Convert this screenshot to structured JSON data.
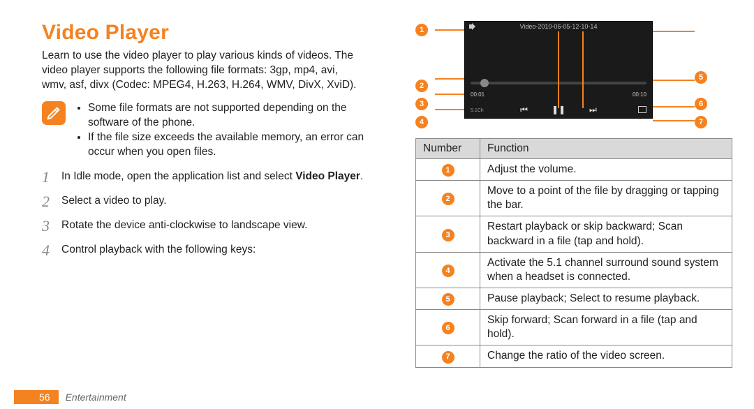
{
  "title": "Video Player",
  "intro": "Learn to use the video player to play various kinds of videos. The video player supports the following file formats: 3gp, mp4, avi, wmv, asf, divx (Codec: MPEG4, H.263, H.264, WMV, DivX, XviD).",
  "notes": [
    "Some file formats are not supported depending on the software of the phone.",
    "If the file size exceeds the available memory, an error can occur when you open files."
  ],
  "steps": [
    {
      "text_pre": "In Idle mode, open the application list and select ",
      "bold": "Video Player",
      "text_post": "."
    },
    {
      "text_pre": "Select a video to play."
    },
    {
      "text_pre": "Rotate the device anti-clockwise to landscape view."
    },
    {
      "text_pre": "Control playback with the following keys:"
    }
  ],
  "screen": {
    "title": "Video-2010-06-05-12-10-14",
    "time_elapsed": "00:01",
    "time_total": "00:10",
    "surround_label": "5.1Ch"
  },
  "table": {
    "headers": [
      "Number",
      "Function"
    ],
    "rows": [
      {
        "n": "1",
        "fn": "Adjust the volume."
      },
      {
        "n": "2",
        "fn": "Move to a point of the file by dragging or tapping the bar."
      },
      {
        "n": "3",
        "fn": "Restart playback or skip backward; Scan backward in a file (tap and hold)."
      },
      {
        "n": "4",
        "fn": "Activate the 5.1 channel surround sound system when a headset is connected."
      },
      {
        "n": "5",
        "fn": "Pause playback; Select to resume playback."
      },
      {
        "n": "6",
        "fn": "Skip forward; Scan forward in a file (tap and hold)."
      },
      {
        "n": "7",
        "fn": "Change the ratio of the video screen."
      }
    ]
  },
  "footer": {
    "page": "56",
    "section": "Entertainment"
  }
}
